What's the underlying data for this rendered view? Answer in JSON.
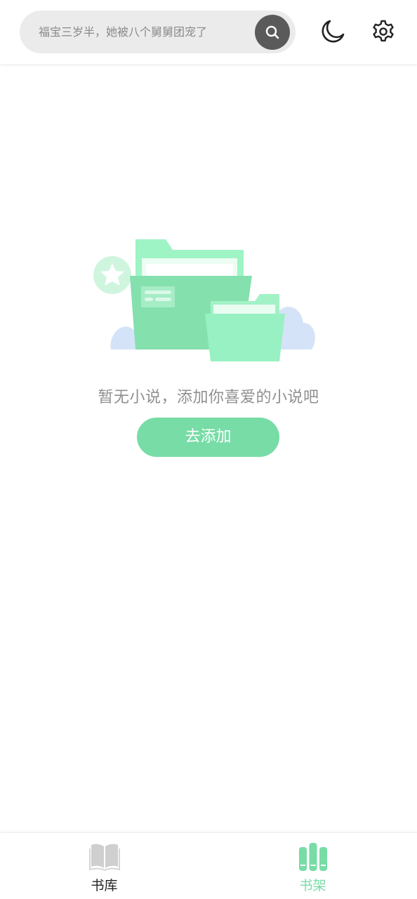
{
  "header": {
    "search_placeholder": "福宝三岁半，她被八个舅舅团宠了",
    "search_icon": "search-icon",
    "night_mode_icon": "moon-icon",
    "settings_icon": "gear-icon"
  },
  "empty_state": {
    "illustration": "empty-folder-illustration",
    "message": "暂无小说，添加你喜爱的小说吧",
    "button_label": "去添加"
  },
  "bottom_nav": {
    "items": [
      {
        "label": "书库",
        "icon": "open-book-icon",
        "active": false
      },
      {
        "label": "书架",
        "icon": "bookshelf-icon",
        "active": true
      }
    ]
  },
  "colors": {
    "accent": "#77dca6",
    "search_bg": "#ebebeb",
    "search_button": "#5a5a5a",
    "text_muted": "#8f8f8f",
    "inactive_icon": "#c8c8c8"
  }
}
